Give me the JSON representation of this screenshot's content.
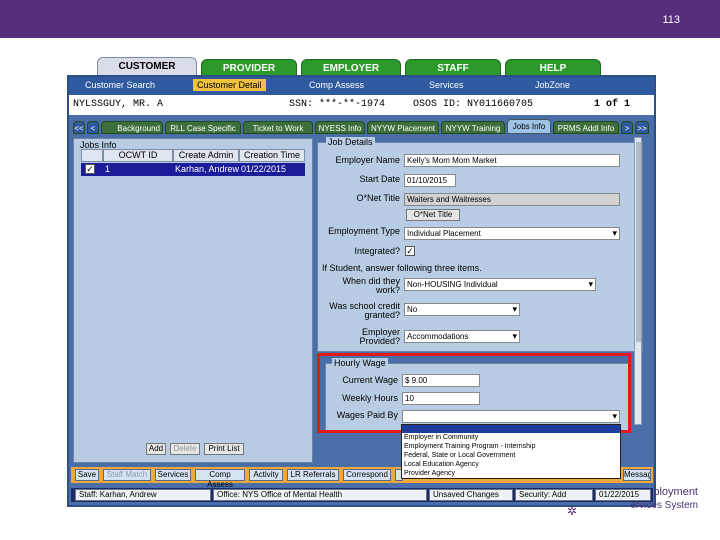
{
  "slide": {
    "page_number": "113"
  },
  "brand": {
    "line1": "ployment",
    "line2": "ervices System"
  },
  "main_tabs": [
    "CUSTOMER",
    "PROVIDER",
    "EMPLOYER",
    "STAFF",
    "HELP"
  ],
  "sub_nav": [
    "Customer Search",
    "Customer Detail",
    "Comp Assess",
    "Services",
    "JobZone"
  ],
  "customer": {
    "name": "NYLSSGUY, MR. A",
    "ssn": "SSN: ***-**-1974",
    "osos_id": "OSOS ID: NY011660705",
    "record_count": "1 of 1"
  },
  "detail_tabs": {
    "prev_first": "<<",
    "prev": "<",
    "items": [
      "Background",
      "RLL Case Specific",
      "Ticket to Work",
      "NYESS Info",
      "NYYW Placement",
      "NYYW Training",
      "Jobs Info",
      "PRMS Addl Info"
    ],
    "next": ">",
    "next_last": ">>"
  },
  "jobs_info": {
    "legend": "Jobs Info",
    "columns": [
      "OCWT ID",
      "Create Admin",
      "Creation Time"
    ],
    "rows": [
      {
        "checked": "✓",
        "id": "1",
        "admin": "Karhan, Andrew",
        "time": "01/22/2015"
      }
    ],
    "buttons": {
      "add": "Add",
      "delete": "Delete",
      "print_list": "Print List"
    }
  },
  "job_details": {
    "legend": "Job Details",
    "employer_name_label": "Employer Name",
    "employer_name_value": "Kelly's Mom Mom Market",
    "start_date_label": "Start Date",
    "start_date_value": "01/10/2015",
    "onet_title_label": "O*Net Title",
    "onet_title_value": "Waiters and Waitresses",
    "onet_button": "O*Net Title",
    "employment_type_label": "Employment Type",
    "employment_type_value": "Individual Placement",
    "integrated_label": "Integrated?",
    "integrated_value": "✓",
    "student_note": "If Student, answer following three items.",
    "when_did_label": "When did they work?",
    "when_did_value": "Non-HOUSING Individual",
    "school_credit_label": "Was school credit granted?",
    "school_credit_value": "No",
    "employer_provided_label": "Employer Provided?",
    "employer_provided_value": "Accommodations"
  },
  "hourly_wage": {
    "legend": "Hourly Wage",
    "current_wage_label": "Current Wage",
    "current_wage_value": "$ 9.00",
    "weekly_hours_label": "Weekly Hours",
    "weekly_hours_value": "10",
    "wages_paid_label": "Wages Paid By",
    "wages_paid_value": ""
  },
  "wages_paid_options": [
    "Employer in Community",
    "Employment Training Program - Internship",
    "Federal, State or Local Government",
    "Local Education Agency",
    "Provider Agency"
  ],
  "action_buttons": [
    "Save",
    "Staff Match",
    "Services",
    "Comp Assess",
    "Activity",
    "LR Referrals",
    "Correspond",
    "Message"
  ],
  "status": {
    "staff": "Staff: Karhan, Andrew",
    "office": "Office: NYS Office of Mental Health",
    "unsaved": "Unsaved Changes",
    "security": "Security: Add",
    "date": "01/22/2015"
  }
}
